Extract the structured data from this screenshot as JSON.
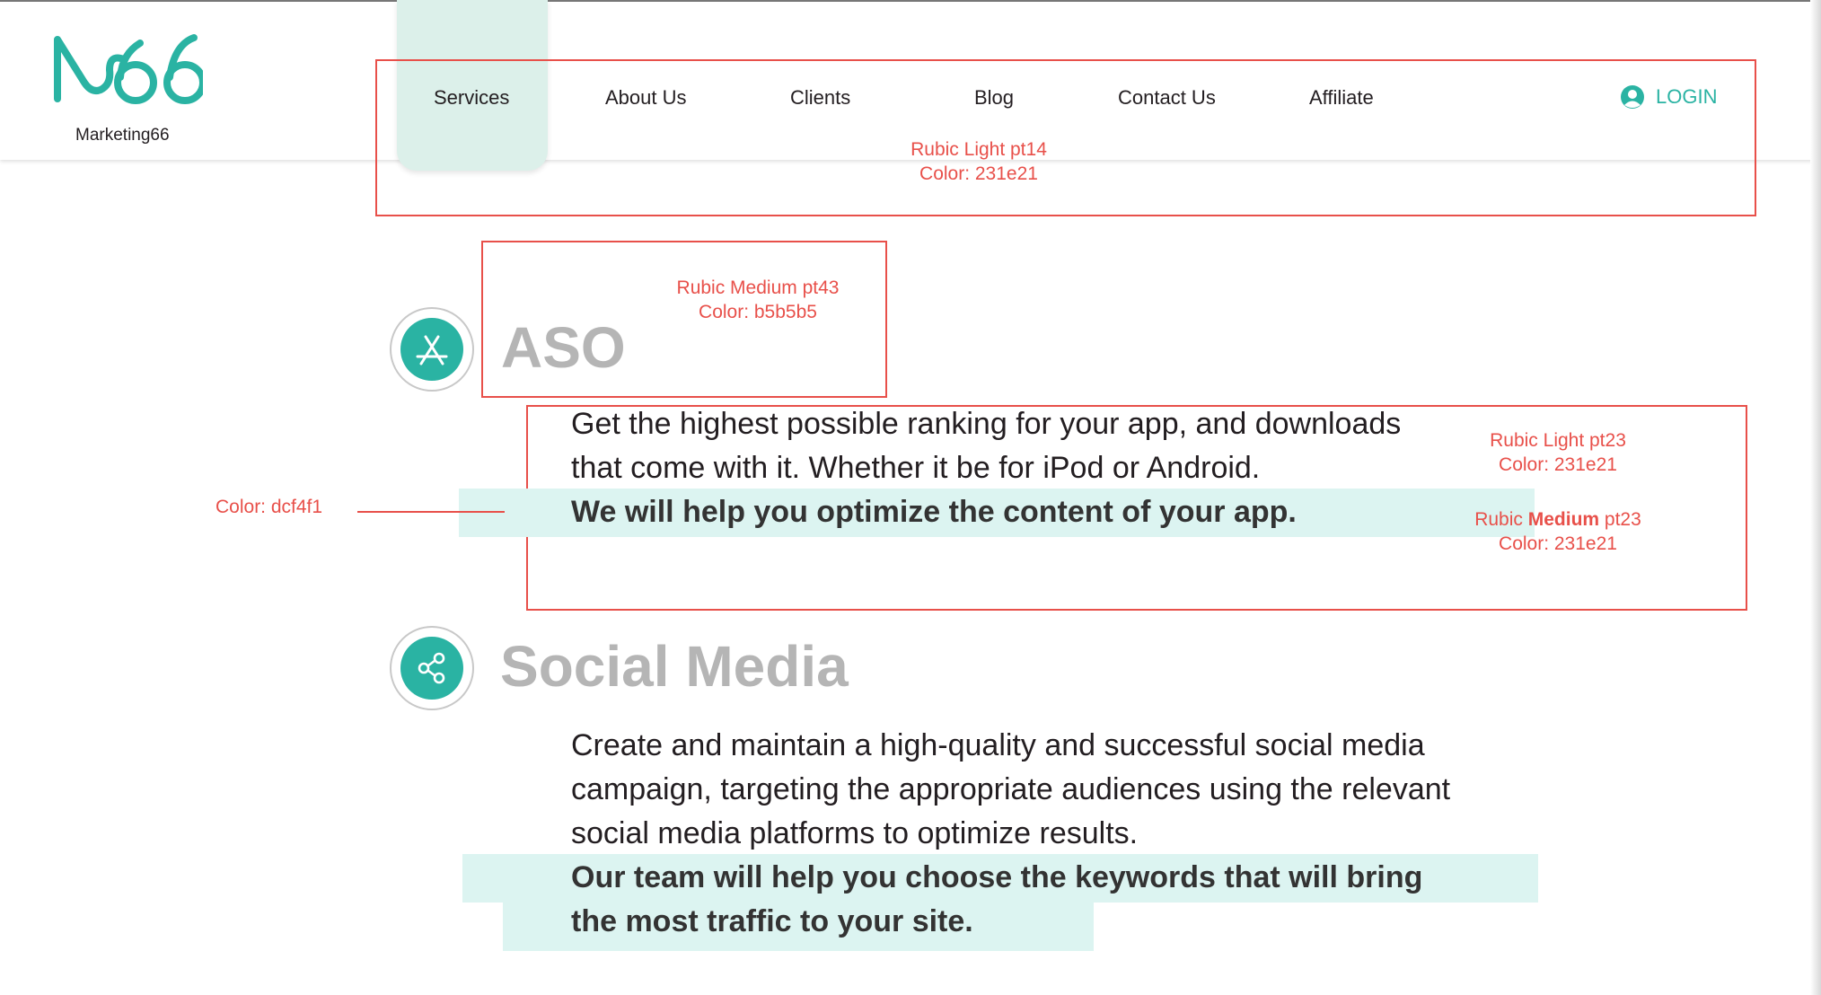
{
  "brand": {
    "name": "Marketing66",
    "accent": "#2ab3a3"
  },
  "nav": {
    "items": [
      {
        "label": "Services",
        "active": true
      },
      {
        "label": "About Us"
      },
      {
        "label": "Clients"
      },
      {
        "label": "Blog"
      },
      {
        "label": "Contact Us"
      },
      {
        "label": "Affiliate"
      }
    ],
    "login_label": "LOGIN"
  },
  "annotations": {
    "nav": {
      "line1": "Rubic Light pt14",
      "line2": "Color: 231e21"
    },
    "title": {
      "line1": "Rubic Medium pt43",
      "line2": "Color: b5b5b5"
    },
    "body": {
      "line1": "Rubic Light pt23",
      "line2": "Color: 231e21"
    },
    "body_bold": {
      "line1_a": "Rubic ",
      "line1_b": "Medium",
      "line1_c": " pt23",
      "line2": "Color: 231e21"
    },
    "highlight": {
      "label": "Color: dcf4f1"
    }
  },
  "sections": [
    {
      "title": "ASO",
      "icon": "app-store-icon",
      "lines": [
        "Get the highest possible ranking for your app, and downloads",
        "that come with it. Whether it be for iPod or Android."
      ],
      "bold_lines": [
        "We will help you optimize the content of your app."
      ]
    },
    {
      "title": "Social Media",
      "icon": "share-icon",
      "lines": [
        "Create and maintain a high-quality and successful social media",
        "campaign, targeting the appropriate audiences using the relevant",
        "social media platforms to optimize results."
      ],
      "bold_lines": [
        "Our team will help you choose the keywords that will bring",
        "the most traffic to your site."
      ]
    }
  ],
  "colors": {
    "text": "#231e21",
    "title": "#b5b5b5",
    "highlight": "#dcf4f1",
    "annotation": "#e8504a"
  }
}
